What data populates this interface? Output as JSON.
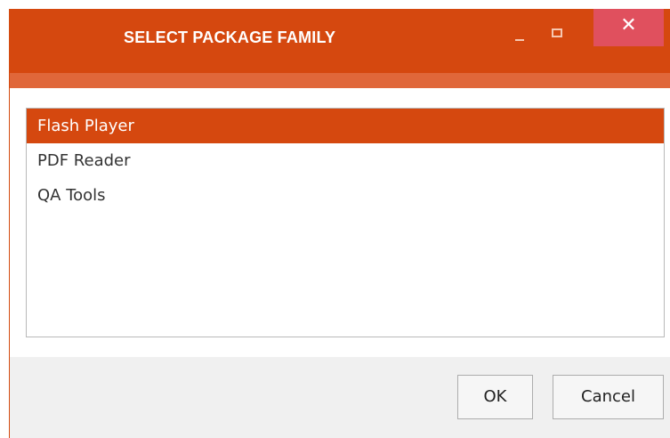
{
  "window": {
    "title": "SELECT PACKAGE FAMILY",
    "controls": {
      "minimize_icon": "minimize-icon",
      "maximize_icon": "maximize-icon",
      "close_glyph": "✕"
    },
    "accent_color": "#d5480f"
  },
  "list": {
    "items": [
      {
        "label": "Flash Player",
        "selected": true
      },
      {
        "label": "PDF Reader",
        "selected": false
      },
      {
        "label": "QA Tools",
        "selected": false
      }
    ]
  },
  "footer": {
    "ok_label": "OK",
    "cancel_label": "Cancel"
  }
}
